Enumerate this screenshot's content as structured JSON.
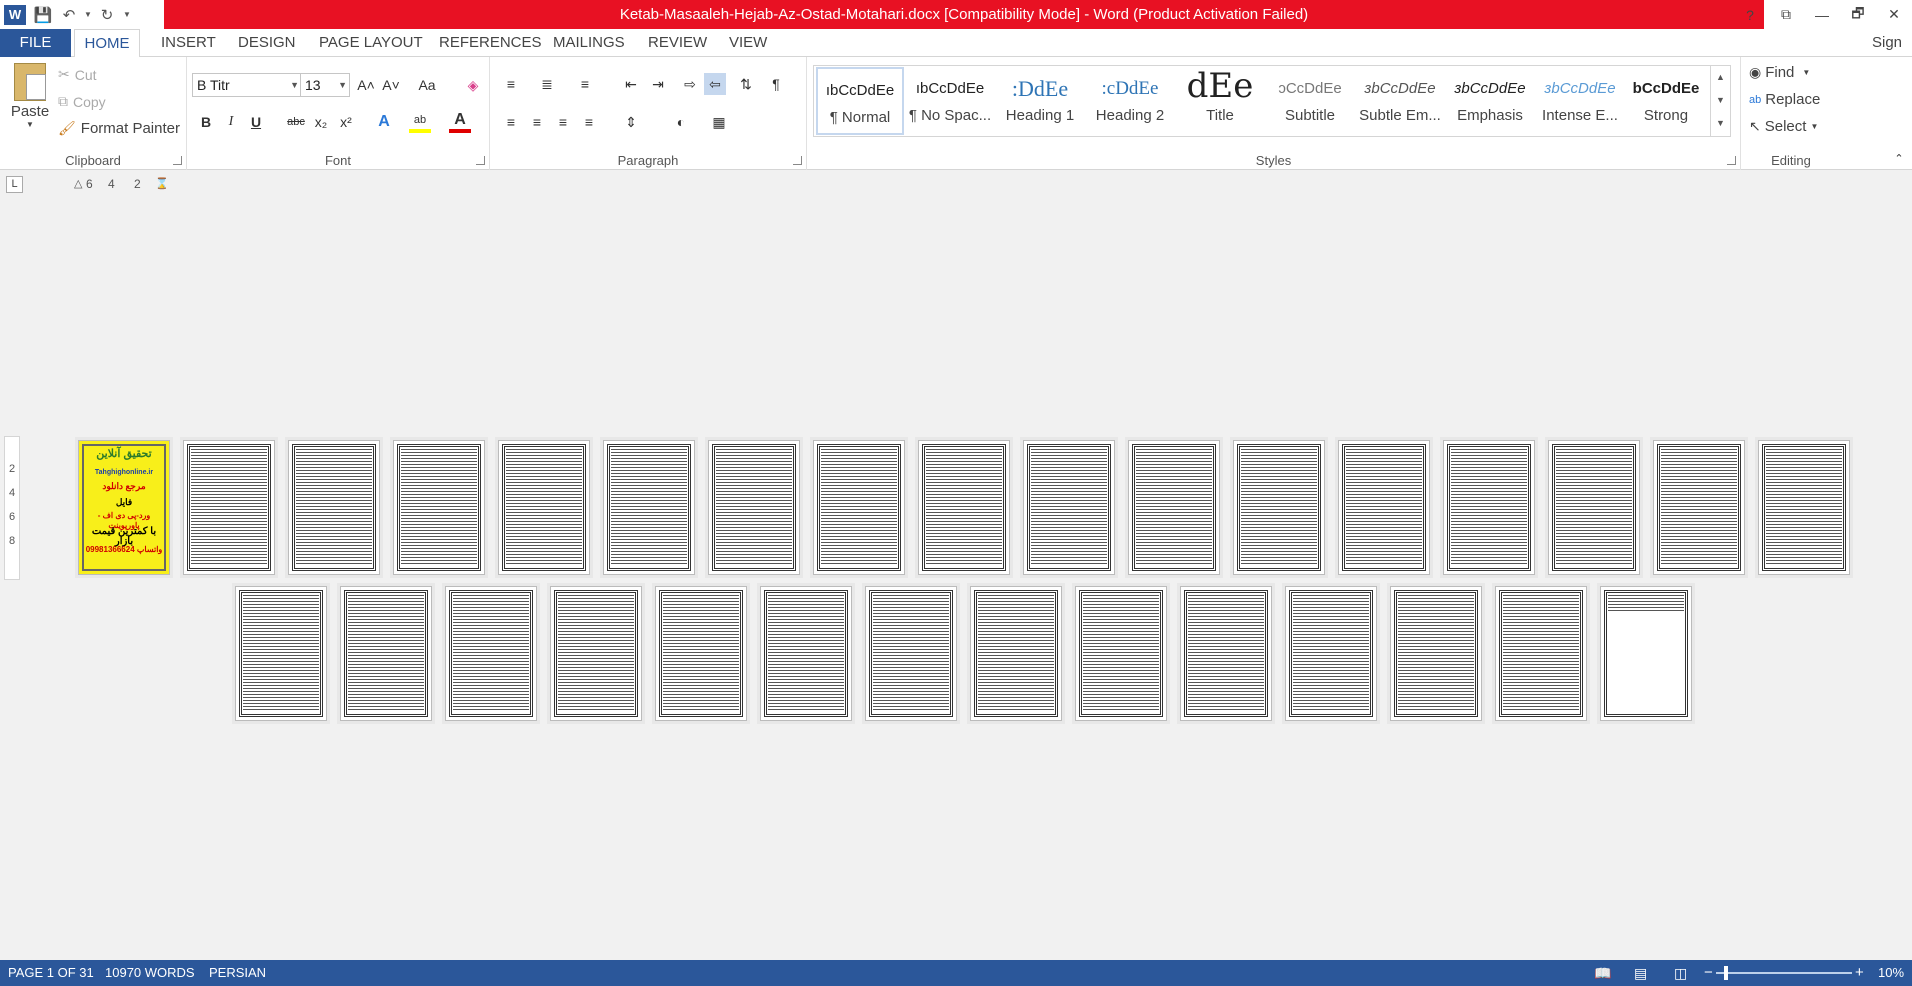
{
  "window": {
    "title": "Ketab-Masaaleh-Hejab-Az-Ostad-Motahari.docx [Compatibility Mode] -  Word (Product Activation Failed)"
  },
  "qat": {
    "word_icon": "word-logo-icon",
    "save_icon": "save-icon",
    "undo_icon": "undo-icon",
    "redo_icon": "redo-icon",
    "customize_icon": "chevron-down-icon"
  },
  "window_controls": {
    "help": "?",
    "restore_ribbon": "⧉",
    "minimize": "—",
    "maximize": "🗗",
    "close": "✕"
  },
  "tabs": {
    "file": "FILE",
    "home": "HOME",
    "insert": "INSERT",
    "design": "DESIGN",
    "page_layout": "PAGE LAYOUT",
    "references": "REFERENCES",
    "mailings": "MAILINGS",
    "review": "REVIEW",
    "view": "VIEW",
    "sign_in": "Sign i"
  },
  "clipboard": {
    "paste": "Paste",
    "cut": "Cut",
    "copy": "Copy",
    "format_painter": "Format Painter",
    "label": "Clipboard"
  },
  "font": {
    "name": "B Titr",
    "size": "13",
    "label": "Font",
    "grow": "A˄",
    "shrink": "A˅",
    "change_case": "Aa",
    "clear": "◈",
    "bold": "B",
    "italic": "I",
    "underline": "U",
    "strike": "abc",
    "subscript": "x₂",
    "superscript": "x²",
    "effects": "A",
    "highlight": "ab",
    "font_color": "A"
  },
  "paragraph": {
    "label": "Paragraph",
    "pilcrow": "¶"
  },
  "styles": {
    "label": "Styles",
    "items": [
      {
        "preview": "ıbCcDdEe",
        "name": "¶ Normal"
      },
      {
        "preview": "ıbCcDdEe",
        "name": "¶ No Spac..."
      },
      {
        "preview": ":DdEe",
        "name": "Heading 1"
      },
      {
        "preview": ":cDdEe",
        "name": "Heading 2"
      },
      {
        "preview": "dEe",
        "name": "Title"
      },
      {
        "preview": "ɔCcDdEe",
        "name": "Subtitle"
      },
      {
        "preview": "ɜbCcDdEe",
        "name": "Subtle Em..."
      },
      {
        "preview": "ɜbCcDdEe",
        "name": "Emphasis"
      },
      {
        "preview": "ɜbCcDdEe",
        "name": "Intense E..."
      },
      {
        "preview": "bCcDdEe",
        "name": "Strong"
      }
    ]
  },
  "editing": {
    "find": "Find",
    "replace": "Replace",
    "select": "Select",
    "label": "Editing"
  },
  "ruler": {
    "tab_selector": "L",
    "marks": [
      "6",
      "4",
      "2"
    ],
    "vmarks": [
      "2",
      "4",
      "6",
      "8"
    ]
  },
  "cover_page": {
    "lines": [
      "تحقیق آنلاین",
      "Tahghighonline.ir",
      "مرجع دانلود",
      "فایل",
      "ورد-پی دی اف - پاورپوینت",
      "با کمترین قیمت بازار",
      "09981366624 واتساپ"
    ]
  },
  "status": {
    "page": "PAGE 1 OF 31",
    "words": "10970 WORDS",
    "language": "PERSIAN",
    "zoom": "10%",
    "zoom_minus": "−",
    "zoom_plus": "+"
  },
  "colors": {
    "accent": "#2b579a",
    "title_bar_red": "#e81123",
    "cover_yellow": "#f8ef1a"
  }
}
